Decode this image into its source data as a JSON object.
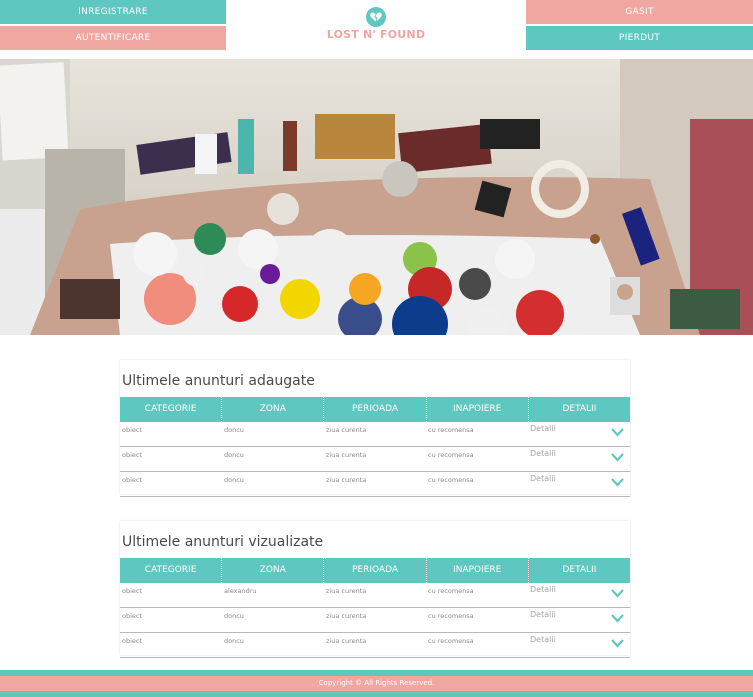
{
  "nav": {
    "register_label": "INREGISTRARE",
    "login_label": "AUTENTIFICARE",
    "found_label": "GASIT",
    "lost_label": "PIERDUT",
    "brand": "LOST N' FOUND"
  },
  "colors": {
    "teal": "#5ec7bf",
    "pink": "#f0a6a1"
  },
  "hero": {
    "icon": "collection-of-items-photo"
  },
  "added": {
    "title": "Ultimele anunturi adaugate",
    "headers": [
      "CATEGORIE",
      "ZONA",
      "PERIOADA",
      "INAPOIERE",
      "DETALII"
    ],
    "rows": [
      {
        "categorie": "obiect",
        "zona": "doncu",
        "perioada": "ziua curenta",
        "inapoiere": "cu recomensa",
        "detalii": "Detalii"
      },
      {
        "categorie": "obiect",
        "zona": "doncu",
        "perioada": "ziua curenta",
        "inapoiere": "cu recomensa",
        "detalii": "Detalii"
      },
      {
        "categorie": "obiect",
        "zona": "doncu",
        "perioada": "ziua curenta",
        "inapoiere": "cu recomensa",
        "detalii": "Detalii"
      }
    ]
  },
  "viewed": {
    "title": "Ultimele anunturi vizualizate",
    "headers": [
      "CATEGORIE",
      "ZONA",
      "PERIOADA",
      "INAPOIERE",
      "DETALII"
    ],
    "rows": [
      {
        "categorie": "obiect",
        "zona": "alexandru",
        "perioada": "ziua curenta",
        "inapoiere": "cu recomensa",
        "detalii": "Detalii"
      },
      {
        "categorie": "obiect",
        "zona": "doncu",
        "perioada": "ziua curenta",
        "inapoiere": "cu recomensa",
        "detalii": "Detalii"
      },
      {
        "categorie": "obiect",
        "zona": "doncu",
        "perioada": "ziua curenta",
        "inapoiere": "cu recomensa",
        "detalii": "Detalii"
      }
    ]
  },
  "footer": {
    "copyright": "Copyright © All Rights Reserved."
  }
}
